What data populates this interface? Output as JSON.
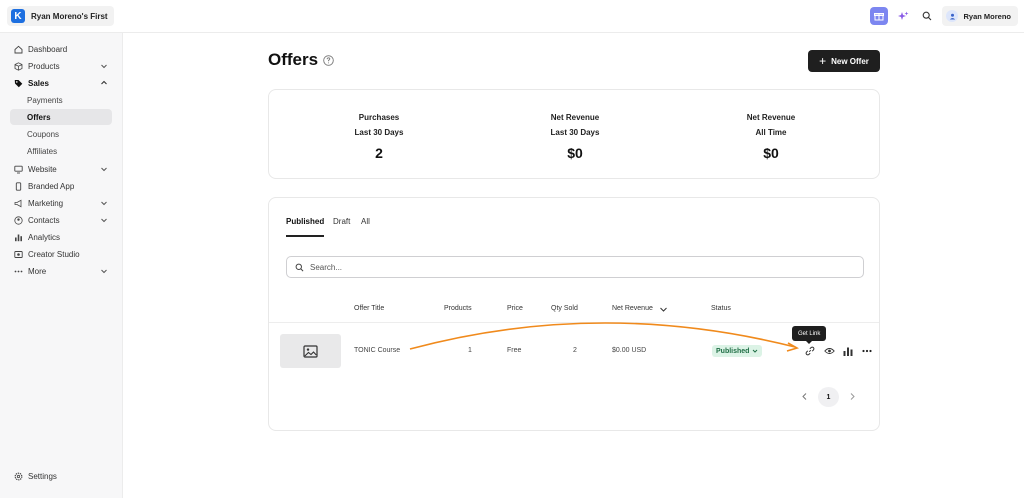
{
  "app": {
    "workspace_name": "Ryan Moreno's First",
    "logo_letter": "K",
    "user_name": "Ryan Moreno"
  },
  "sidebar": {
    "items": [
      {
        "label": "Dashboard",
        "icon": "home-icon"
      },
      {
        "label": "Products",
        "icon": "box-icon",
        "expand": "down"
      },
      {
        "label": "Sales",
        "icon": "tag-icon",
        "expand": "up",
        "bold": true
      },
      {
        "label": "Website",
        "icon": "monitor-icon",
        "expand": "down"
      },
      {
        "label": "Branded App",
        "icon": "phone-icon"
      },
      {
        "label": "Marketing",
        "icon": "megaphone-icon",
        "expand": "down"
      },
      {
        "label": "Contacts",
        "icon": "contacts-icon",
        "expand": "down"
      },
      {
        "label": "Analytics",
        "icon": "bar-chart-icon"
      },
      {
        "label": "Creator Studio",
        "icon": "studio-icon"
      },
      {
        "label": "More",
        "icon": "dots-icon",
        "expand": "down"
      }
    ],
    "sales_sub": [
      "Payments",
      "Offers",
      "Coupons",
      "Affiliates"
    ],
    "active_sub": "Offers",
    "settings_label": "Settings"
  },
  "page": {
    "title": "Offers",
    "new_offer_label": "New Offer"
  },
  "stats": [
    {
      "line1": "Purchases",
      "line2": "Last 30 Days",
      "value": "2"
    },
    {
      "line1": "Net Revenue",
      "line2": "Last 30 Days",
      "value": "$0"
    },
    {
      "line1": "Net Revenue",
      "line2": "All Time",
      "value": "$0"
    }
  ],
  "tabs": [
    "Published",
    "Draft",
    "All"
  ],
  "active_tab": "Published",
  "search": {
    "placeholder": "Search..."
  },
  "table": {
    "headers": [
      "Offer Title",
      "Products",
      "Price",
      "Qty Sold",
      "Net Revenue",
      "Status"
    ],
    "rows": [
      {
        "title": "TONIC Course",
        "products": "1",
        "price": "Free",
        "qty_sold": "2",
        "net_revenue": "$0.00 USD",
        "status": "Published"
      }
    ]
  },
  "tooltip": "Get Link",
  "pagination": {
    "current_page": "1"
  },
  "colors": {
    "accent": "#1d6fe0",
    "annotation_arrow": "#f08a1c",
    "published_badge": "#dcf3e6"
  }
}
